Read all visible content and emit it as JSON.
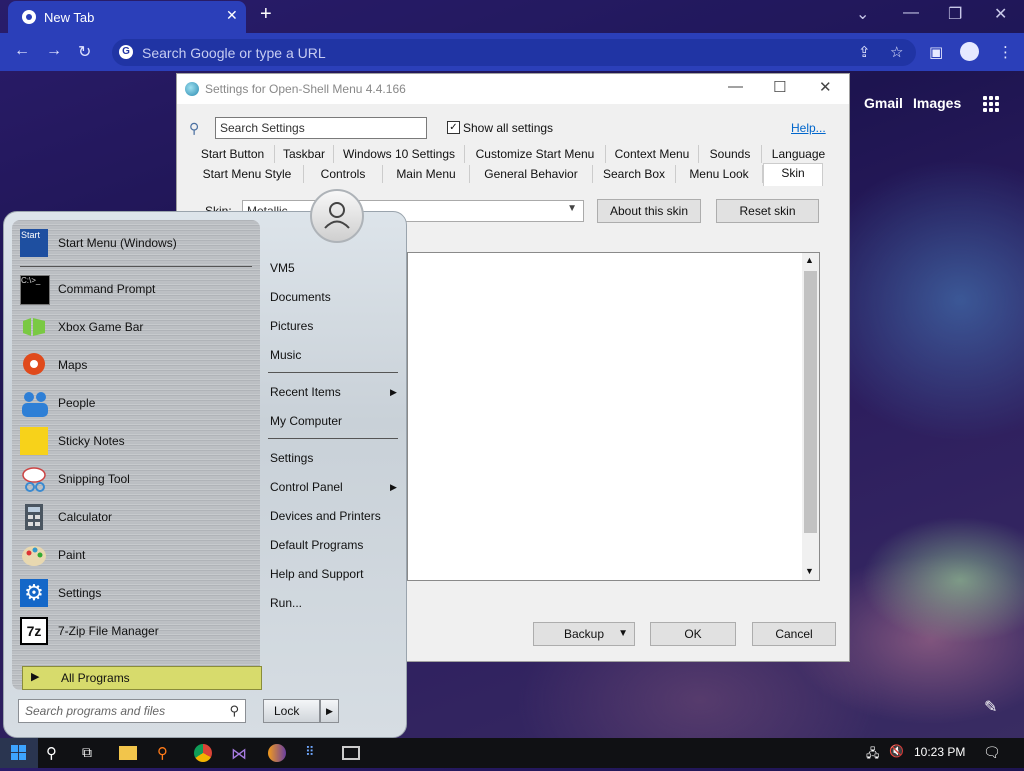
{
  "browser": {
    "tab_title": "New Tab",
    "tab_close": "✕",
    "new_tab": "+",
    "omnibox_placeholder": "Search Google or type a URL",
    "links": {
      "gmail": "Gmail",
      "images": "Images"
    }
  },
  "settings": {
    "title": "Settings for Open-Shell Menu 4.4.166",
    "search_placeholder": "Search Settings",
    "show_all_label": "Show all settings",
    "show_all_checked": true,
    "help_link": "Help...",
    "tabs_row1": [
      "Start Button",
      "Taskbar",
      "Windows 10 Settings",
      "Customize Start Menu",
      "Context Menu",
      "Sounds",
      "Language"
    ],
    "tabs_row2": [
      "Start Menu Style",
      "Controls",
      "Main Menu",
      "General Behavior",
      "Search Box",
      "Menu Look",
      "Skin"
    ],
    "selected_tab": "Skin",
    "skin_label": "Skin:",
    "skin_value": "Metallic",
    "about_skin_button": "About this skin",
    "reset_skin_button": "Reset skin",
    "backup_button": "Backup",
    "ok_button": "OK",
    "cancel_button": "Cancel"
  },
  "start_menu": {
    "programs": [
      {
        "label": "Start Menu (Windows)",
        "icon": "start-menu-icon"
      },
      {
        "label": "Command Prompt",
        "icon": "command-prompt-icon"
      },
      {
        "label": "Xbox Game Bar",
        "icon": "xbox-icon"
      },
      {
        "label": "Maps",
        "icon": "maps-icon"
      },
      {
        "label": "People",
        "icon": "people-icon"
      },
      {
        "label": "Sticky Notes",
        "icon": "sticky-notes-icon"
      },
      {
        "label": "Snipping Tool",
        "icon": "snipping-tool-icon"
      },
      {
        "label": "Calculator",
        "icon": "calculator-icon"
      },
      {
        "label": "Paint",
        "icon": "paint-icon"
      },
      {
        "label": "Settings",
        "icon": "settings-gear-icon"
      },
      {
        "label": "7-Zip File Manager",
        "icon": "7zip-icon"
      }
    ],
    "start_icon_text": "Start",
    "cmd_icon_text": "C:\\>_",
    "sevenzip_icon_text": "7z",
    "all_programs": "All Programs",
    "search_placeholder": "Search programs and files",
    "lock_button": "Lock",
    "right_items": {
      "vm5": "VM5",
      "documents": "Documents",
      "pictures": "Pictures",
      "music": "Music",
      "recent_items": "Recent Items",
      "my_computer": "My Computer",
      "settings": "Settings",
      "control_panel": "Control Panel",
      "devices_printers": "Devices and Printers",
      "default_programs": "Default Programs",
      "help_support": "Help and Support",
      "run": "Run..."
    }
  },
  "taskbar": {
    "clock": "10:23 PM"
  },
  "colors": {
    "chrome_accent": "#2b3fb9",
    "all_programs_highlight": "#d7db6c",
    "taskbar": "#101114"
  }
}
